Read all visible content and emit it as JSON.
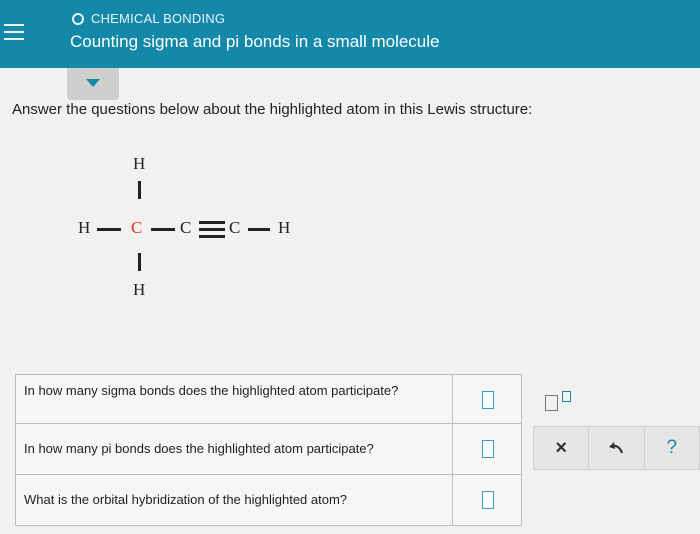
{
  "header": {
    "topic": "CHEMICAL BONDING",
    "title": "Counting sigma and pi bonds in a small molecule"
  },
  "prompt": "Answer the questions below about the highlighted atom in this Lewis structure:",
  "lewis": {
    "h_top": "H",
    "h_left": "H",
    "c_highlighted": "C",
    "c_middle": "C",
    "c_right": "C",
    "h_right": "H",
    "h_bottom": "H",
    "highlight_color": "#e03020"
  },
  "questions": [
    {
      "text": "In how many sigma bonds does the highlighted atom participate?",
      "value": ""
    },
    {
      "text": "In how many pi bonds does the highlighted atom participate?",
      "value": ""
    },
    {
      "text": "What is the orbital hybridization of the highlighted atom?",
      "value": ""
    }
  ],
  "tools": {
    "clear": "×",
    "help": "?"
  },
  "colors": {
    "header": "#1488a8",
    "background": "#f1f1ef"
  }
}
